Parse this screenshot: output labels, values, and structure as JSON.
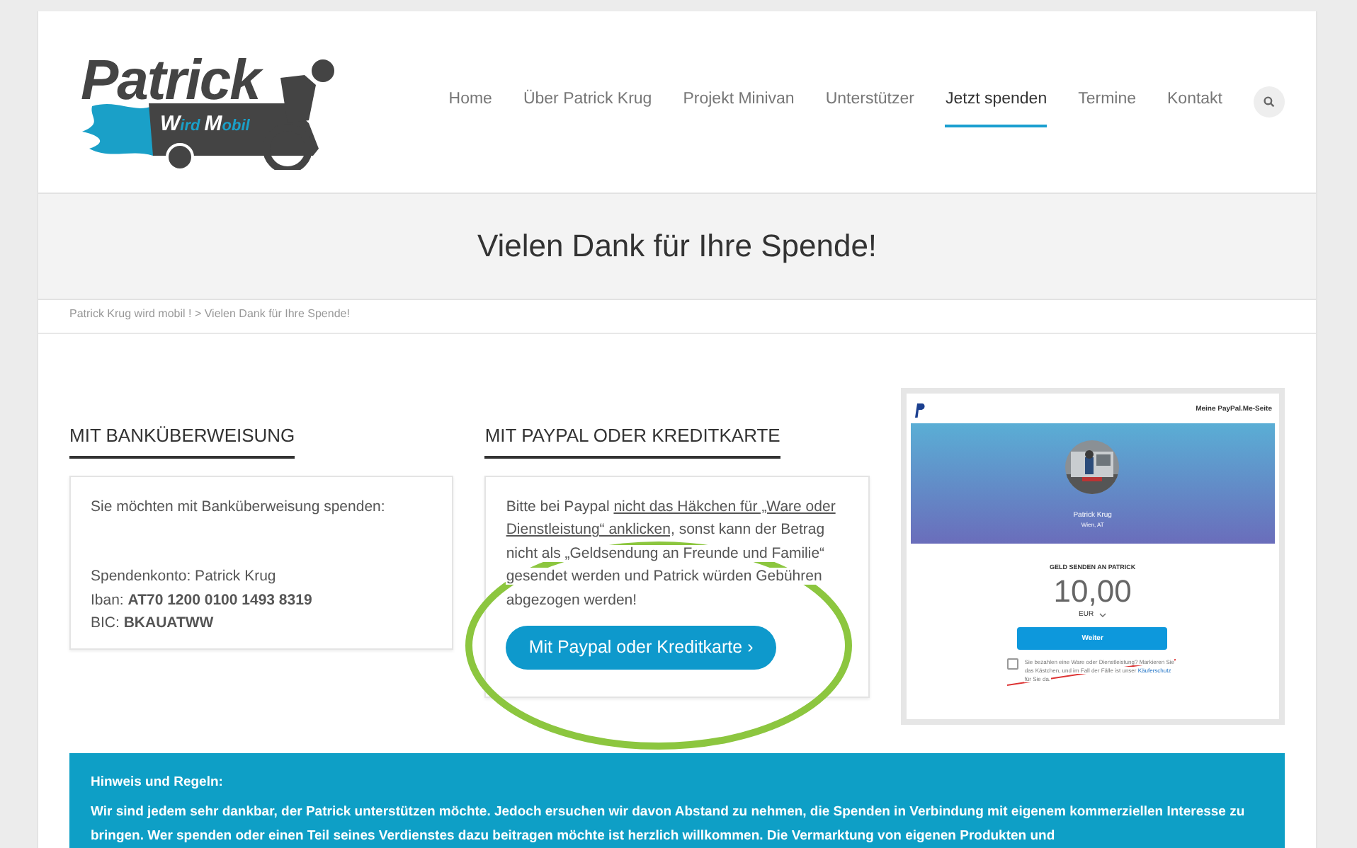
{
  "logo": {
    "title": "Patrick",
    "subtitle_parts": [
      {
        "text": "W",
        "kind": "initial"
      },
      {
        "text": "ird ",
        "kind": "plain"
      },
      {
        "text": "M",
        "kind": "initial"
      },
      {
        "text": "obil",
        "kind": "plain"
      }
    ]
  },
  "nav": [
    {
      "label": "Home",
      "selected": false
    },
    {
      "label": "Über Patrick Krug",
      "selected": false
    },
    {
      "label": "Projekt Minivan",
      "selected": false
    },
    {
      "label": "Unterstützer",
      "selected": false
    },
    {
      "label": "Jetzt spenden",
      "selected": true
    },
    {
      "label": "Termine",
      "selected": false
    },
    {
      "label": "Kontakt",
      "selected": false
    }
  ],
  "page_title": "Vielen Dank für Ihre Spende!",
  "breadcrumb": "Patrick Krug wird mobil ! > Vielen Dank für Ihre Spende!",
  "bank": {
    "heading": "MIT BANKÜBERWEISUNG",
    "intro": "Sie möchten mit Banküberweisung spenden:",
    "lines": [
      "Spendenkonto: Patrick Krug",
      "Iban: **AT70 1200 0100 1493 8319**",
      "BIC: **BKAUATWW**"
    ]
  },
  "paypal": {
    "heading": "MIT PAYPAL ODER KREDITKARTE",
    "text_before": "Bitte bei Paypal",
    "link_lines": [
      "nicht das Häkchen für „Ware oder",
      "Dienstleistung“ anklicken"
    ],
    "text_after": ", sonst kann der Betrag nicht als „Geldsendung an Freunde und Familie“ gesendet werden und Patrick würden Gebühren abgezogen werden!",
    "button": "Mit Paypal oder Kreditkarte ›"
  },
  "paypal_screenshot": {
    "header_link": "Meine PayPal.Me-Seite",
    "name": "Patrick Krug",
    "location": "Wien, AT",
    "send_label": "GELD SENDEN AN PATRICK",
    "amount": "10,00",
    "currency": "EUR",
    "button": "Weiter",
    "checkbox": {
      "checked": false,
      "text_before": "Sie bezahlen eine Ware oder Dienstleistung? Markieren Sie das Kästchen, und im Fall der Fälle ist unser",
      "link": "Käuferschutz",
      "text_after": "für Sie da."
    }
  },
  "notice": {
    "title": "Hinweis und Regeln:",
    "text": "Wir sind jedem sehr dankbar, der Patrick unterstützen möchte. Jedoch ersuchen wir davon Abstand zu nehmen, die Spenden in Verbindung mit eigenem kommerziellen Interesse zu bringen. Wer spenden oder einen Teil seines Verdienstes dazu beitragen möchte ist herzlich willkommen. Die Vermarktung von eigenen Produkten und"
  }
}
